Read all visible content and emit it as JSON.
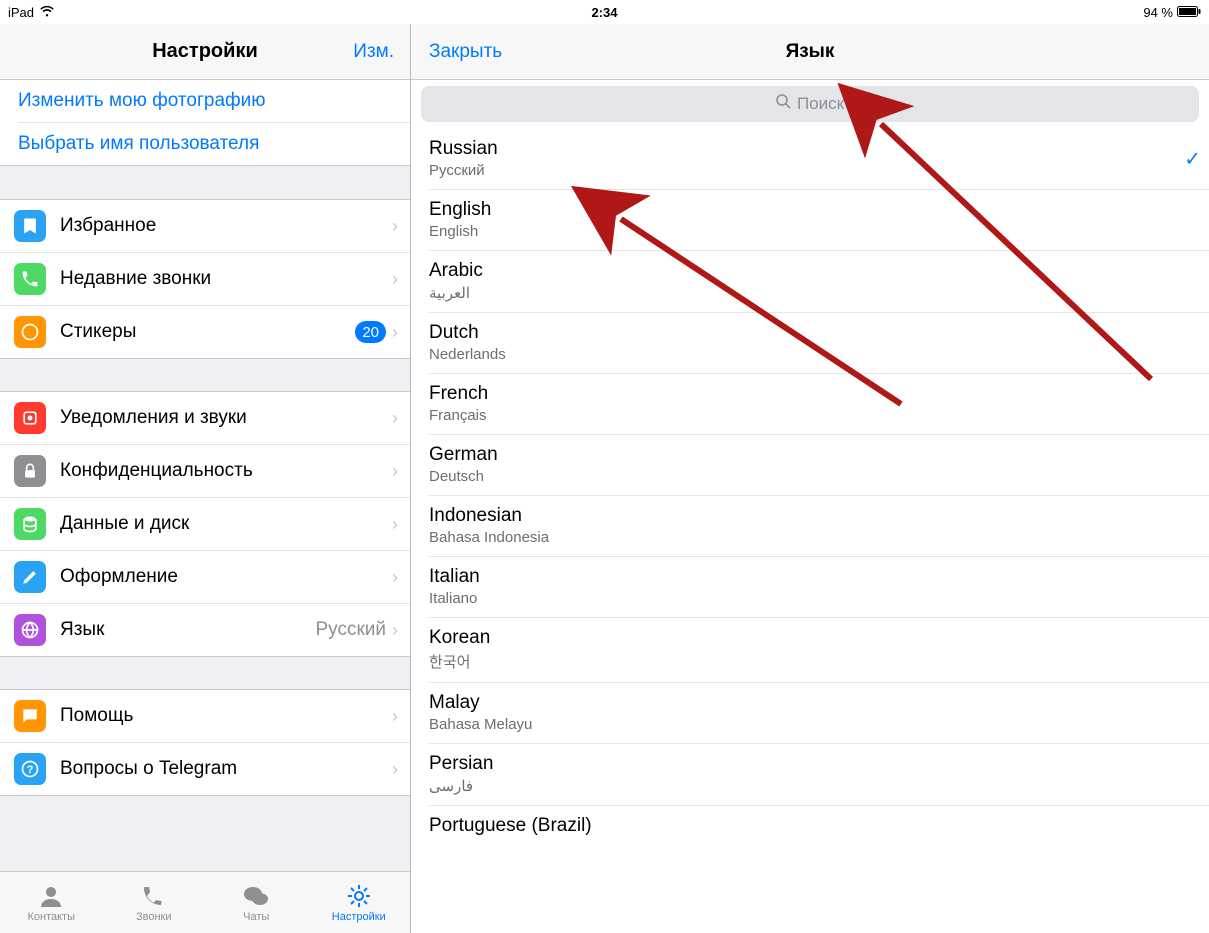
{
  "statusbar": {
    "device": "iPad",
    "time": "2:34",
    "battery": "94 %"
  },
  "left": {
    "title": "Настройки",
    "edit": "Изм.",
    "links": {
      "change_photo": "Изменить мою фотографию",
      "choose_username": "Выбрать имя пользователя"
    },
    "group1": {
      "favorites": "Избранное",
      "recent_calls": "Недавние звонки",
      "stickers": "Стикеры",
      "stickers_badge": "20"
    },
    "group2": {
      "notifications": "Уведомления и звуки",
      "privacy": "Конфиденциальность",
      "data": "Данные и диск",
      "appearance": "Оформление",
      "language": "Язык",
      "language_value": "Русский"
    },
    "group3": {
      "help": "Помощь",
      "faq": "Вопросы о Telegram"
    }
  },
  "tabs": {
    "contacts": "Контакты",
    "calls": "Звонки",
    "chats": "Чаты",
    "settings": "Настройки"
  },
  "right": {
    "close": "Закрыть",
    "title": "Язык",
    "search_placeholder": "Поиск",
    "languages": [
      {
        "name": "Russian",
        "native": "Русский",
        "selected": true
      },
      {
        "name": "English",
        "native": "English"
      },
      {
        "name": "Arabic",
        "native": "العربية"
      },
      {
        "name": "Dutch",
        "native": "Nederlands"
      },
      {
        "name": "French",
        "native": "Français"
      },
      {
        "name": "German",
        "native": "Deutsch"
      },
      {
        "name": "Indonesian",
        "native": "Bahasa Indonesia"
      },
      {
        "name": "Italian",
        "native": "Italiano"
      },
      {
        "name": "Korean",
        "native": "한국어"
      },
      {
        "name": "Malay",
        "native": "Bahasa Melayu"
      },
      {
        "name": "Persian",
        "native": "فارسى"
      },
      {
        "name": "Portuguese (Brazil)",
        "native": ""
      }
    ]
  },
  "colors": {
    "accent": "#007aff",
    "icon_blue": "#2aa3f5",
    "icon_green": "#4cd964",
    "icon_orange": "#ff9500",
    "icon_red": "#ff3b30",
    "icon_gray": "#8e8e93",
    "icon_teal": "#34c759",
    "icon_purple": "#af52de"
  }
}
